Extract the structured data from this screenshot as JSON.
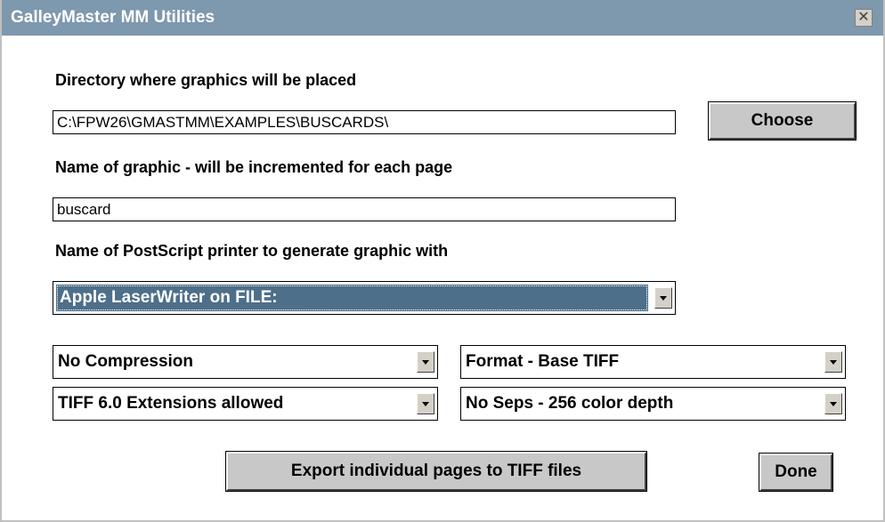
{
  "window": {
    "title": "GalleyMaster MM Utilities",
    "close_icon": "close-icon",
    "close_glyph": "✕"
  },
  "directory": {
    "label": "Directory where graphics will be placed",
    "value": "C:\\FPW26\\GMASTMM\\EXAMPLES\\BUSCARDS\\",
    "choose_label": "Choose"
  },
  "graphic_name": {
    "label": "Name of graphic - will be incremented for each page",
    "value": "buscard"
  },
  "printer": {
    "label": "Name of PostScript printer to generate graphic with",
    "selected": "Apple LaserWriter on FILE:"
  },
  "options": {
    "compression": "No Compression",
    "format": "Format - Base TIFF",
    "extensions": "TIFF 6.0 Extensions allowed",
    "seps": "No Seps - 256 color depth"
  },
  "actions": {
    "export_label": "Export individual pages to TIFF files",
    "done_label": "Done"
  },
  "colors": {
    "titlebar": "#7e98ad",
    "selection": "#4d6f8a",
    "button_face": "#c8c8c8"
  }
}
